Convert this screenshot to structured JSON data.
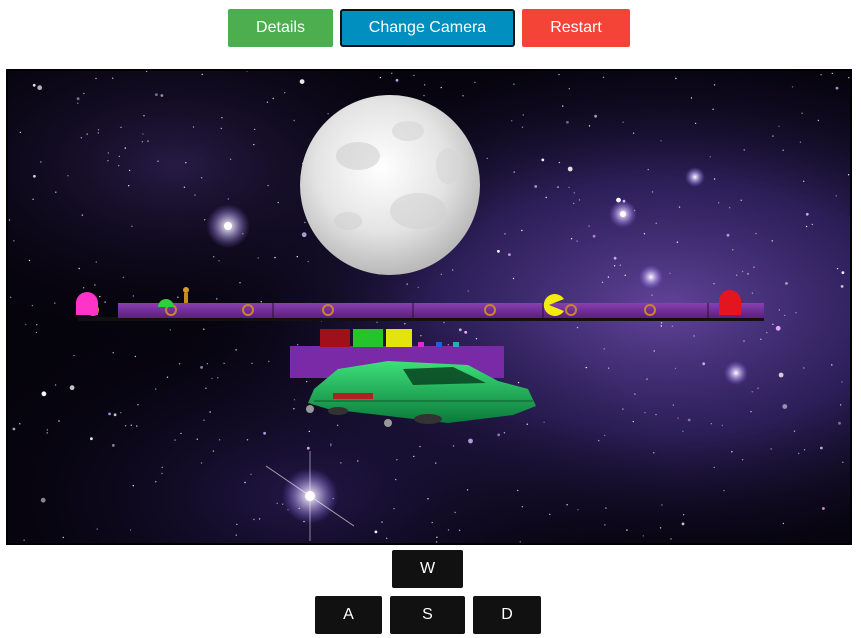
{
  "toolbar": {
    "details_label": "Details",
    "camera_label": "Change Camera",
    "restart_label": "Restart",
    "details_color": "#4cae4f",
    "camera_color": "#008fbf",
    "restart_color": "#f44437"
  },
  "scene": {
    "background": "starfield-nebula",
    "objects": [
      "moon",
      "track",
      "pink-ghost",
      "green-ghost",
      "red-ghost",
      "pacman",
      "figure",
      "blocks",
      "hover-car"
    ]
  },
  "controls": {
    "up": "W",
    "left": "A",
    "down": "S",
    "right": "D"
  }
}
